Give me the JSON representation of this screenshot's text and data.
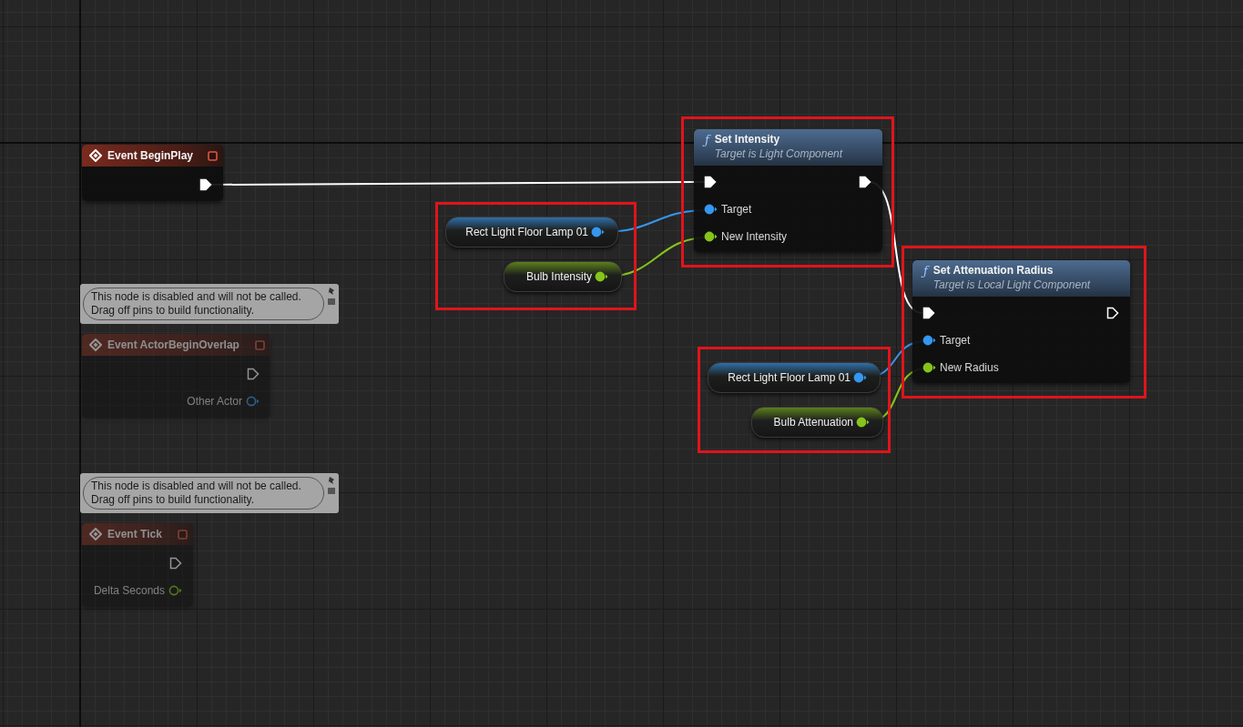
{
  "graph": {
    "event_nodes": [
      {
        "title": "Event BeginPlay",
        "disabled": false,
        "pins": [
          {
            "kind": "exec",
            "connected": true
          }
        ]
      },
      {
        "title": "Event ActorBeginOverlap",
        "disabled": true,
        "comment": "This node is disabled and will not be called.\nDrag off pins to build functionality.",
        "pins": [
          {
            "kind": "exec",
            "connected": false
          },
          {
            "kind": "object",
            "label": "Other Actor",
            "connected": false
          }
        ]
      },
      {
        "title": "Event Tick",
        "disabled": true,
        "comment": "This node is disabled and will not be called.\nDrag off pins to build functionality.",
        "pins": [
          {
            "kind": "exec",
            "connected": false
          },
          {
            "kind": "float",
            "label": "Delta Seconds",
            "connected": false
          }
        ]
      }
    ],
    "function_nodes": [
      {
        "icon": "ƒ",
        "title": "Set Intensity",
        "subtitle": "Target is Light Component",
        "highlighted": true,
        "inputs": [
          {
            "kind": "exec",
            "connected": true
          },
          {
            "kind": "object",
            "label": "Target",
            "connected": true
          },
          {
            "kind": "float",
            "label": "New Intensity",
            "connected": true
          }
        ],
        "outputs": [
          {
            "kind": "exec",
            "connected": true
          }
        ]
      },
      {
        "icon": "ƒ",
        "title": "Set Attenuation Radius",
        "subtitle": "Target is Local Light Component",
        "highlighted": true,
        "inputs": [
          {
            "kind": "exec",
            "connected": true
          },
          {
            "kind": "object",
            "label": "Target",
            "connected": true
          },
          {
            "kind": "float",
            "label": "New Radius",
            "connected": true
          }
        ],
        "outputs": [
          {
            "kind": "exec",
            "connected": false
          }
        ]
      }
    ],
    "variable_groups": [
      {
        "highlighted": true,
        "variables": [
          {
            "name": "Rect Light Floor Lamp 01",
            "kind": "object",
            "connected": true
          },
          {
            "name": "Bulb Intensity",
            "kind": "float",
            "connected": true
          }
        ]
      },
      {
        "highlighted": true,
        "variables": [
          {
            "name": "Rect Light Floor Lamp 01",
            "kind": "object",
            "connected": true
          },
          {
            "name": "Bulb Attenuation",
            "kind": "float",
            "connected": true
          }
        ]
      }
    ]
  }
}
